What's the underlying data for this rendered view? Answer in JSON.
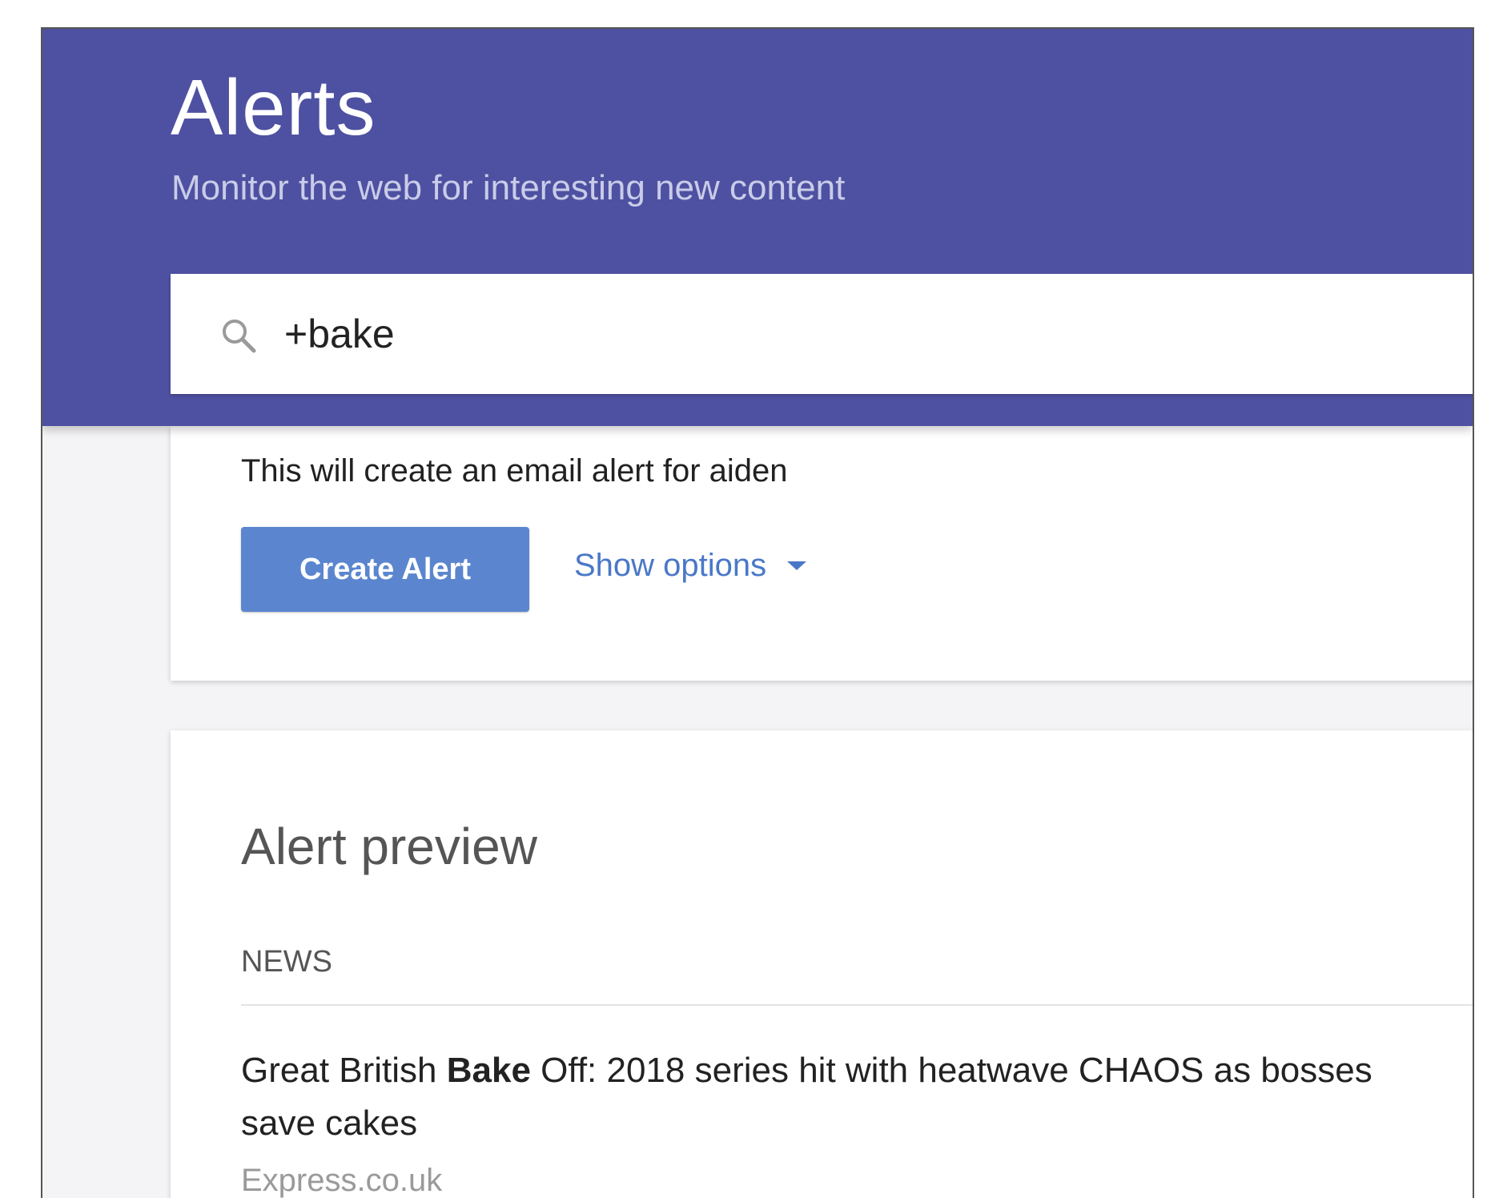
{
  "header": {
    "title": "Alerts",
    "subtitle": "Monitor the web for interesting new content",
    "background_color": "#4e51a1"
  },
  "search": {
    "icon": "search-icon",
    "value": "+bake"
  },
  "create_card": {
    "note": "This will create an email alert for aiden",
    "create_button_label": "Create Alert",
    "show_options_label": "Show options",
    "button_color": "#5b86cf",
    "link_color": "#4a78c8"
  },
  "preview": {
    "title": "Alert preview",
    "section": "NEWS",
    "items": [
      {
        "title_before": "Great British ",
        "title_highlight": "Bake",
        "title_after": " Off: 2018 series hit with heatwave CHAOS as bosses",
        "title_line2": "save cakes",
        "source": "Express.co.uk"
      }
    ]
  }
}
